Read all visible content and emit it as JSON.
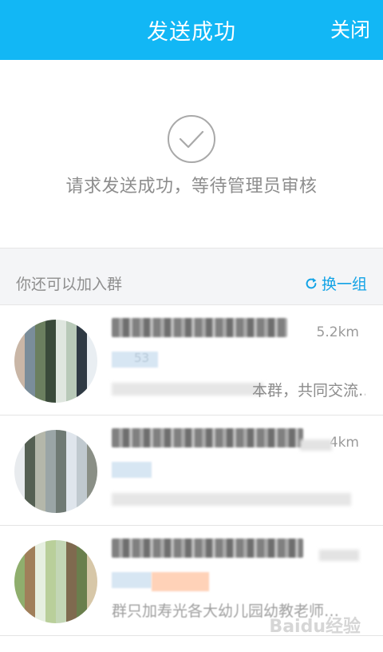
{
  "header": {
    "title": "发送成功",
    "close_label": "关闭",
    "bg_color": "#12b7f5"
  },
  "success": {
    "icon": "check-circle-icon",
    "message": "请求发送成功，等待管理员审核"
  },
  "recommend": {
    "title": "你还可以加入群",
    "refresh_label": "换一组",
    "refresh_icon": "refresh-icon",
    "accent_color": "#12a3e6"
  },
  "groups": [
    {
      "distance": "5.2km",
      "tag_text": "53",
      "description": "本群，共同交流…"
    },
    {
      "distance": "4km",
      "tag_text": "",
      "description": ""
    },
    {
      "distance": "",
      "tag_text": "",
      "description": "群只加寿光各大幼儿园幼教老师…"
    }
  ],
  "watermark": "Baidu经验"
}
